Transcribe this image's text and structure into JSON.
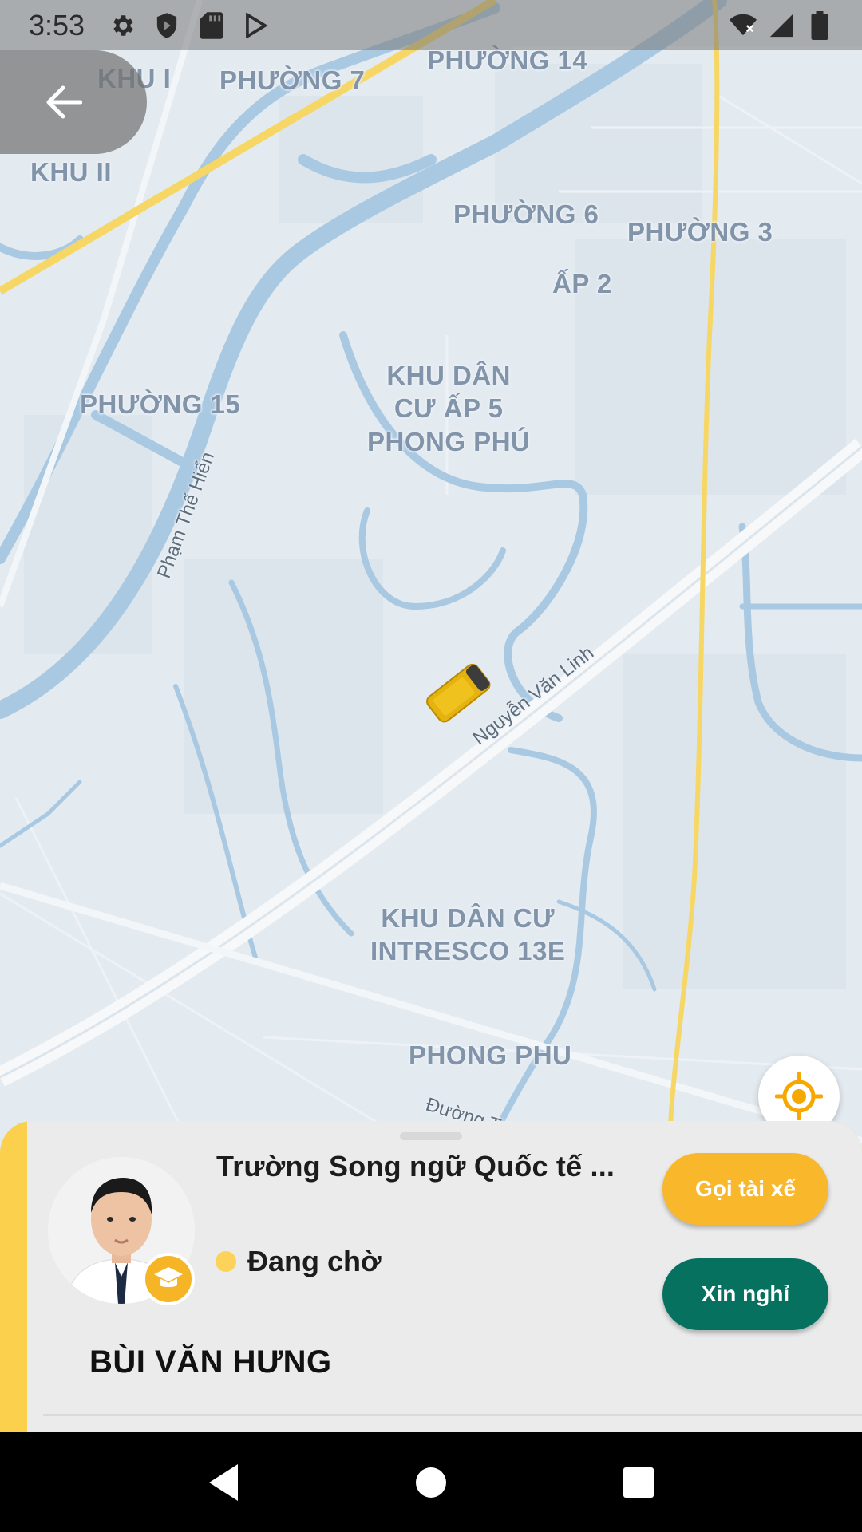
{
  "status_bar": {
    "time": "3:53",
    "icons": [
      "settings-icon",
      "shield-icon",
      "sd-card-icon",
      "play-store-icon"
    ],
    "right_icons": [
      "wifi-icon",
      "signal-icon",
      "battery-icon"
    ]
  },
  "map": {
    "area_labels": [
      "KHU I",
      "PHƯỜNG 7",
      "PHƯỜNG 14",
      "KHU II",
      "PHƯỜNG 6",
      "PHƯỜNG 3",
      "ẤP 2",
      "PHƯỜNG 15",
      "KHU DÂN\nCƯ ẤP 5\nPHONG PHÚ",
      "KHU DÂN CƯ\nINTRESCO 13E",
      "PHONG PHU"
    ],
    "road_labels": [
      "Phạm Thế Hiển",
      "Nguyễn Văn Linh",
      "Đường T"
    ]
  },
  "buttons": {
    "back": "back-arrow-icon",
    "locate": "locate-icon"
  },
  "card": {
    "school_name": "Trường Song ngữ Quốc tế ...",
    "status": "Đang chờ",
    "driver_name": "BÙI VĂN HƯNG",
    "call_driver_label": "Gọi tài xế",
    "leave_label": "Xin nghỉ"
  },
  "colors": {
    "accent_yellow": "#f9b82c",
    "leave_green": "#077160",
    "status_dot": "#fcd25a",
    "card_edge": "#fbd04d"
  },
  "nav": {
    "icons": [
      "back-triangle-icon",
      "home-circle-icon",
      "recents-square-icon"
    ]
  }
}
